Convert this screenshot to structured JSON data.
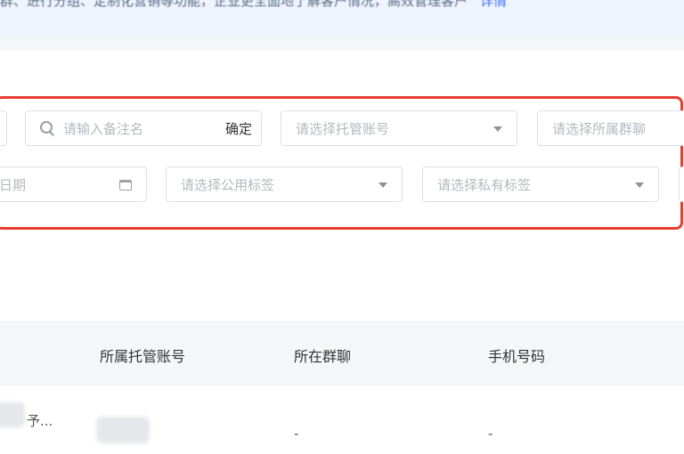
{
  "notice": {
    "text": "群、进行分组、定制化营销等功能，企业更全面地了解客户情况，高效管理客户",
    "link": "详情"
  },
  "filters": {
    "search_placeholder": "请输入备注名",
    "search_confirm": "确定",
    "account_placeholder": "请选择托管账号",
    "group_placeholder": "请选择所属群聊",
    "date_placeholder": "日期",
    "public_tag_placeholder": "请选择公用标签",
    "private_tag_placeholder": "请选择私有标签"
  },
  "table": {
    "columns": [
      "所属托管账号",
      "所在群聊",
      "手机号码"
    ],
    "rows": [
      {
        "name": "予...",
        "group": "-",
        "phone": "-"
      }
    ]
  }
}
